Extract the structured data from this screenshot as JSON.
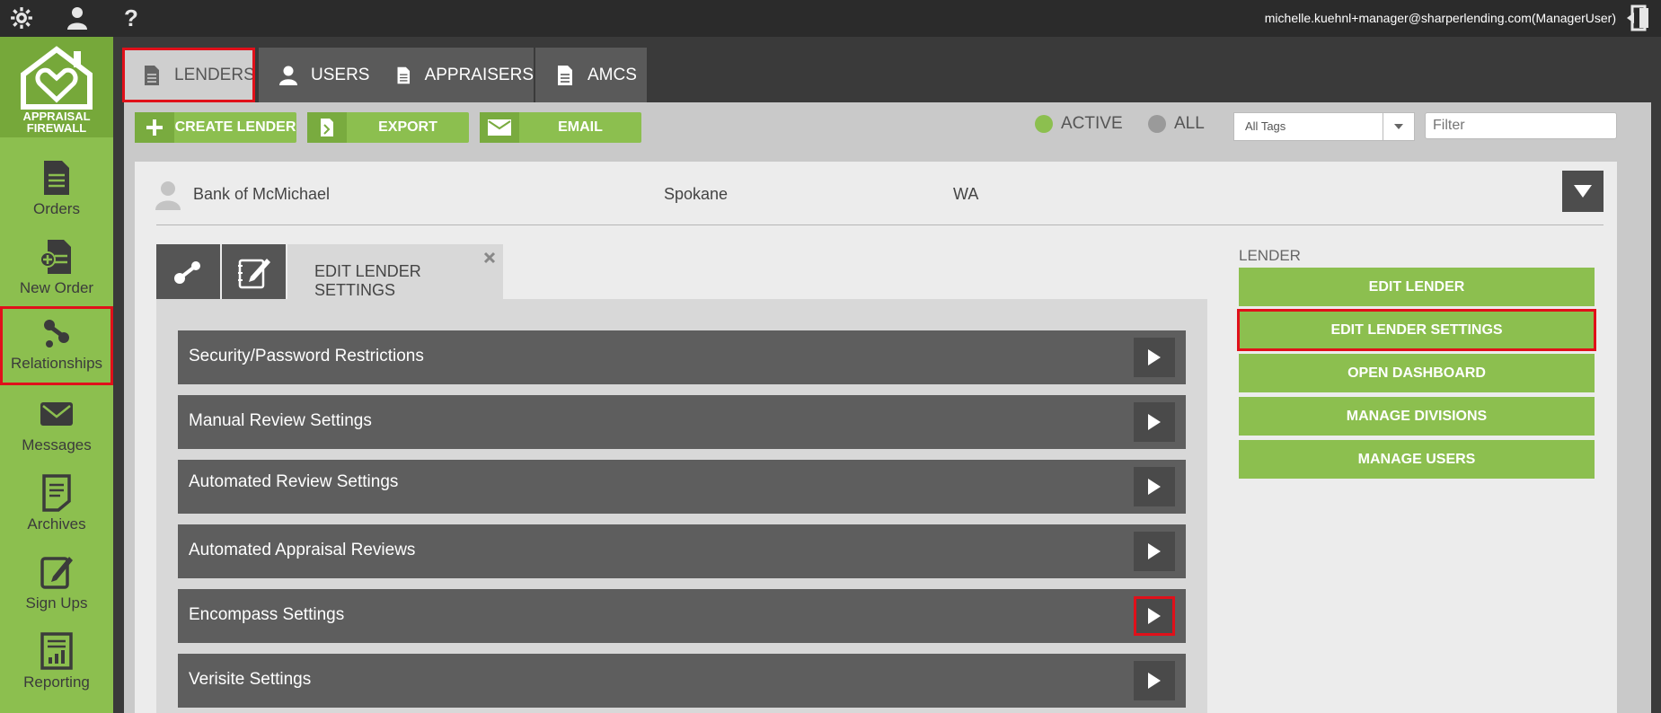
{
  "topbar": {
    "user_email": "michelle.kuehnl+manager@sharperlending.com(ManagerUser)",
    "icons": [
      "gear-icon",
      "user-icon",
      "help-icon",
      "logout-icon"
    ]
  },
  "logo": {
    "line1": "APPRAISAL",
    "line2": "FIREWALL"
  },
  "sidebar": {
    "items": [
      {
        "label": "Orders",
        "icon": "document-icon"
      },
      {
        "label": "New Order",
        "icon": "new-order-icon"
      },
      {
        "label": "Relationships",
        "icon": "relationships-icon",
        "selected": true
      },
      {
        "label": "Messages",
        "icon": "envelope-icon"
      },
      {
        "label": "Archives",
        "icon": "archive-icon"
      },
      {
        "label": "Sign Ups",
        "icon": "signup-icon"
      },
      {
        "label": "Reporting",
        "icon": "report-icon"
      }
    ]
  },
  "tabs": [
    {
      "label": "LENDERS",
      "active": true
    },
    {
      "label": "USERS"
    },
    {
      "label": "APPRAISERS"
    },
    {
      "label": "AMCS"
    }
  ],
  "toolbar": {
    "create_label": "CREATE LENDER",
    "export_label": "EXPORT",
    "email_label": "EMAIL",
    "active_label": "ACTIVE",
    "all_label": "ALL",
    "tags_value": "All Tags",
    "filter_placeholder": "Filter"
  },
  "lender": {
    "name": "Bank of McMichael",
    "city": "Spokane",
    "state": "WA"
  },
  "subtabs": {
    "edit_settings_label": "EDIT LENDER SETTINGS"
  },
  "settings": [
    "Security/Password Restrictions",
    "Manual Review Settings",
    "Automated Review Settings",
    "Automated Appraisal Reviews",
    "Encompass Settings",
    "Verisite Settings"
  ],
  "right_panel": {
    "heading": "LENDER",
    "buttons": [
      "EDIT LENDER",
      "EDIT LENDER SETTINGS",
      "OPEN DASHBOARD",
      "MANAGE DIVISIONS",
      "MANAGE USERS"
    ]
  },
  "colors": {
    "accent_green": "#8cbf4f",
    "highlight_red": "#e0101a",
    "dark_gray": "#5e5e5e"
  }
}
